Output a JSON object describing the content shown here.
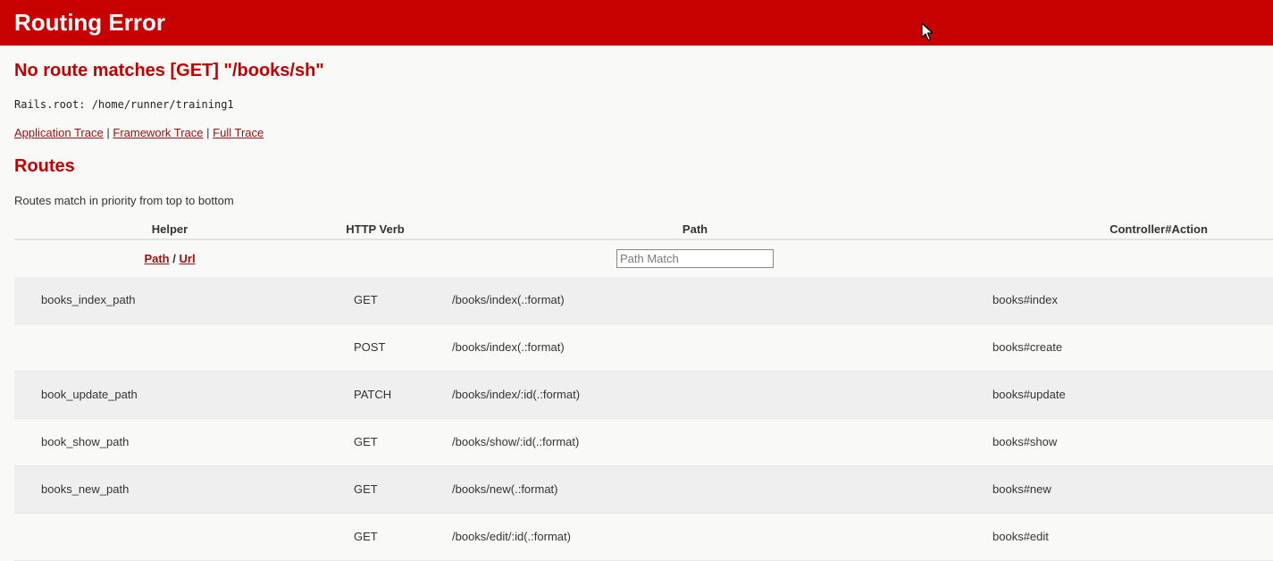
{
  "header": {
    "title": "Routing Error"
  },
  "error": {
    "message": "No route matches [GET] \"/books/sh\"",
    "rails_root": "Rails.root: /home/runner/training1"
  },
  "trace_links": {
    "application": "Application Trace",
    "separator": "|",
    "framework": "Framework Trace",
    "full": "Full Trace"
  },
  "routes": {
    "heading": "Routes",
    "description": "Routes match in priority from top to bottom",
    "columns": {
      "helper": "Helper",
      "verb": "HTTP Verb",
      "path": "Path",
      "action": "Controller#Action"
    },
    "path_link": "Path",
    "url_separator": "/",
    "url_link": "Url",
    "path_match_placeholder": "Path Match",
    "rows": [
      {
        "helper": "books_index_path",
        "verb": "GET",
        "path": "/books/index(.:format)",
        "action": "books#index"
      },
      {
        "helper": "",
        "verb": "POST",
        "path": "/books/index(.:format)",
        "action": "books#create"
      },
      {
        "helper": "book_update_path",
        "verb": "PATCH",
        "path": "/books/index/:id(.:format)",
        "action": "books#update"
      },
      {
        "helper": "book_show_path",
        "verb": "GET",
        "path": "/books/show/:id(.:format)",
        "action": "books#show"
      },
      {
        "helper": "books_new_path",
        "verb": "GET",
        "path": "/books/new(.:format)",
        "action": "books#new"
      },
      {
        "helper": "",
        "verb": "GET",
        "path": "/books/edit/:id(.:format)",
        "action": "books#edit"
      }
    ]
  },
  "colors": {
    "header_bg": "#c70000",
    "heading_red": "#c00000",
    "link": "#9a0e0e"
  }
}
